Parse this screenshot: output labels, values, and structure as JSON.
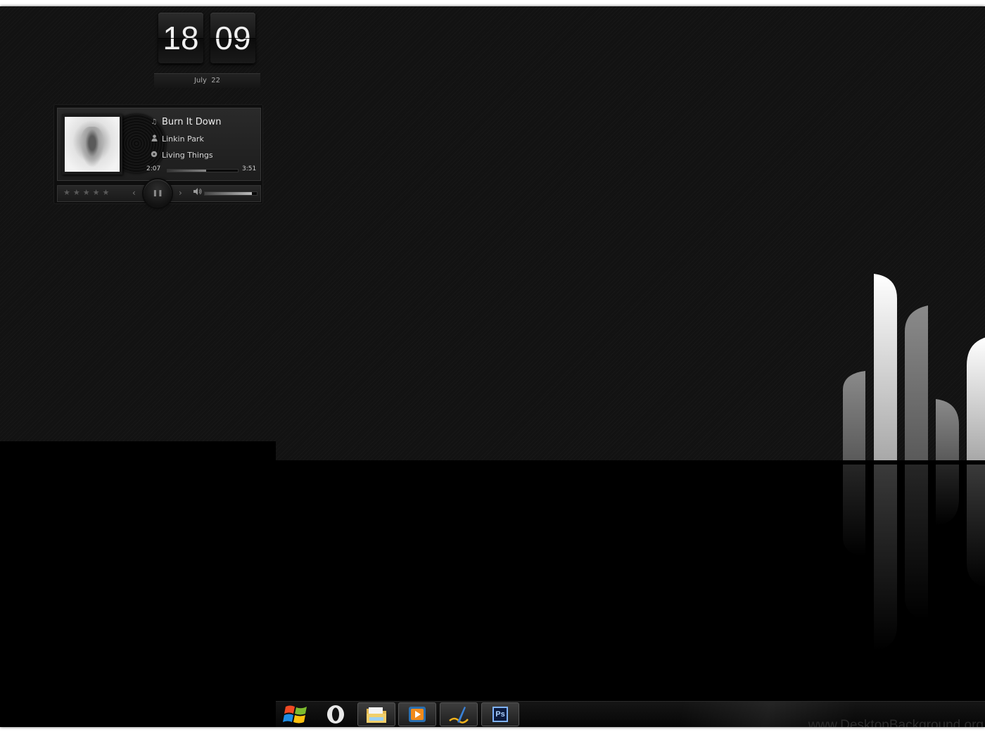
{
  "clock": {
    "hour": "18",
    "minute": "09",
    "date": "July  22"
  },
  "player": {
    "title": "Burn It Down",
    "artist": "Linkin Park",
    "album": "Living Things",
    "elapsed": "2:07",
    "total": "3:51",
    "progress_fraction": 0.55,
    "volume_fraction": 0.9,
    "rating_stars": [
      "★",
      "★",
      "★",
      "★",
      "★"
    ],
    "prev_glyph": "‹",
    "next_glyph": "›",
    "play_pause_glyph": "❚❚",
    "volume_glyph": "🔊"
  },
  "taskbar": {
    "buttons": [
      {
        "id": "start",
        "icon": "windows-logo-icon"
      },
      {
        "id": "opera",
        "icon": "opera-icon"
      },
      {
        "id": "explorer",
        "icon": "folder-icon"
      },
      {
        "id": "media",
        "icon": "media-player-icon"
      },
      {
        "id": "signature",
        "icon": "pen-icon"
      },
      {
        "id": "photoshop",
        "icon": "photoshop-icon",
        "label": "Ps"
      }
    ]
  },
  "watermark": "www.DesktopBackground.org",
  "colors": {
    "background": "#000000",
    "wall": "#121212",
    "text": "#d6d6d6"
  }
}
